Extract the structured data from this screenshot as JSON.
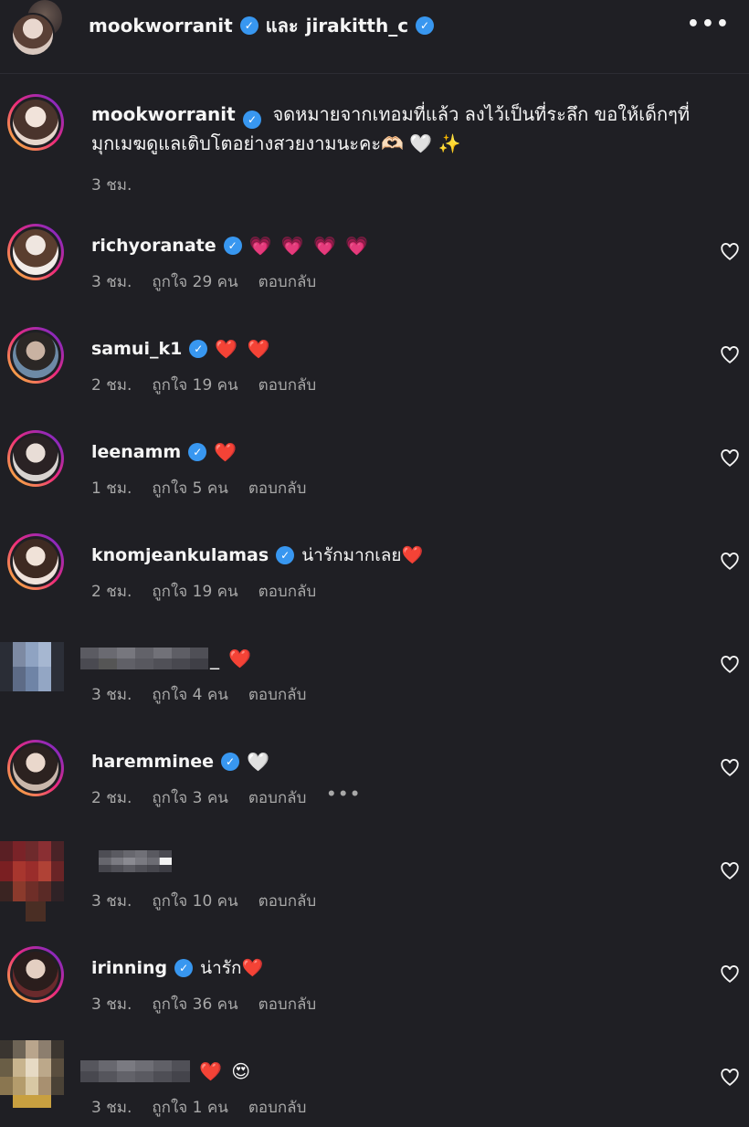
{
  "header": {
    "user1": "mookworranit",
    "joiner": "และ",
    "user2": "jirakitth_c",
    "more_icon": "more-horizontal-icon"
  },
  "caption": {
    "username": "mookworranit",
    "text": "จดหมายจากเทอมที่แล้ว ลงไว้เป็นที่ระลึก ขอให้เด็กๆที่มุกเมฆดูแลเติบโตอย่างสวยงามนะคะ🫶🏻 🤍 ✨",
    "time": "3 ชม."
  },
  "comments": [
    {
      "username": "richyoranate",
      "verified": true,
      "text": "💗 💗 💗 💗",
      "time": "3 ชม.",
      "likes": "ถูกใจ 29 คน",
      "reply": "ตอบกลับ"
    },
    {
      "username": "samui_k1",
      "verified": true,
      "text": "❤️ ❤️",
      "time": "2 ชม.",
      "likes": "ถูกใจ 19 คน",
      "reply": "ตอบกลับ"
    },
    {
      "username": "leenamm",
      "verified": true,
      "text": "❤️",
      "time": "1 ชม.",
      "likes": "ถูกใจ 5 คน",
      "reply": "ตอบกลับ"
    },
    {
      "username": "knomjeankulamas",
      "verified": true,
      "text": "น่ารักมากเลย❤️",
      "time": "2 ชม.",
      "likes": "ถูกใจ 19 คน",
      "reply": "ตอบกลับ"
    },
    {
      "username": "",
      "verified": false,
      "text": "_ ❤️",
      "time": "3 ชม.",
      "likes": "ถูกใจ 4 คน",
      "reply": "ตอบกลับ"
    },
    {
      "username": "haremminee",
      "verified": true,
      "text": "🤍",
      "time": "2 ชม.",
      "likes": "ถูกใจ 3 คน",
      "reply": "ตอบกลับ",
      "more": "•••"
    },
    {
      "username": "",
      "verified": false,
      "text": "",
      "time": "3 ชม.",
      "likes": "ถูกใจ 10 คน",
      "reply": "ตอบกลับ"
    },
    {
      "username": "irinning",
      "verified": true,
      "text": "น่ารัก❤️",
      "time": "3 ชม.",
      "likes": "ถูกใจ 36 คน",
      "reply": "ตอบกลับ"
    },
    {
      "username": "",
      "verified": false,
      "text": "❤️ 😍",
      "time": "3 ชม.",
      "likes": "ถูกใจ 1 คน",
      "reply": "ตอบกลับ"
    }
  ],
  "colors": {
    "background": "#1f1f24",
    "verified": "#3897f0",
    "muted": "#a8a8a8"
  }
}
